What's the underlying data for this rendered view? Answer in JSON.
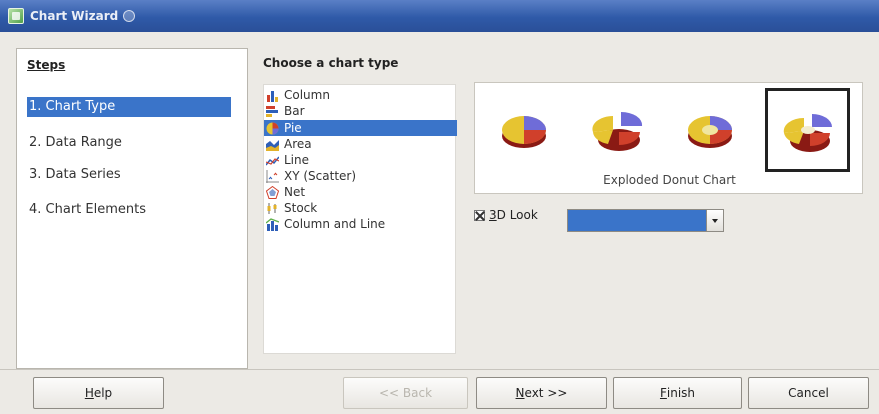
{
  "window": {
    "title": "Chart Wizard"
  },
  "steps": {
    "title": "Steps",
    "items": [
      {
        "label": "1. Chart Type",
        "selected": true
      },
      {
        "label": "2. Data Range",
        "selected": false
      },
      {
        "label": "3. Data Series",
        "selected": false
      },
      {
        "label": "4. Chart Elements",
        "selected": false
      }
    ]
  },
  "content": {
    "title": "Choose a chart type"
  },
  "chart_types": [
    {
      "label": "Column",
      "icon": "column-chart-icon"
    },
    {
      "label": "Bar",
      "icon": "bar-chart-icon"
    },
    {
      "label": "Pie",
      "icon": "pie-chart-icon",
      "selected": true
    },
    {
      "label": "Area",
      "icon": "area-chart-icon"
    },
    {
      "label": "Line",
      "icon": "line-chart-icon"
    },
    {
      "label": "XY (Scatter)",
      "icon": "scatter-chart-icon"
    },
    {
      "label": "Net",
      "icon": "net-chart-icon"
    },
    {
      "label": "Stock",
      "icon": "stock-chart-icon"
    },
    {
      "label": "Column and Line",
      "icon": "column-line-chart-icon"
    }
  ],
  "variants": {
    "selected_name": "Exploded Donut Chart",
    "items": [
      {
        "icon": "pie-chart-icon"
      },
      {
        "icon": "exploded-pie-chart-icon"
      },
      {
        "icon": "donut-chart-icon"
      },
      {
        "icon": "exploded-donut-chart-icon",
        "selected": true
      }
    ]
  },
  "look": {
    "label_mnemonic": "3",
    "label_rest": "D Look",
    "checked": true,
    "value": ""
  },
  "buttons": {
    "help": {
      "mnemonic": "H",
      "rest": "elp"
    },
    "back": {
      "label": "<< Back",
      "enabled": false
    },
    "next": {
      "mnemonic": "N",
      "rest": "ext >>"
    },
    "finish": {
      "mnemonic": "F",
      "rest": "inish"
    },
    "cancel": {
      "label": "Cancel"
    }
  },
  "colors": {
    "selection": "#3a74c9",
    "titlebar": "#2f5aa8",
    "dialog_bg": "#eceae5"
  }
}
